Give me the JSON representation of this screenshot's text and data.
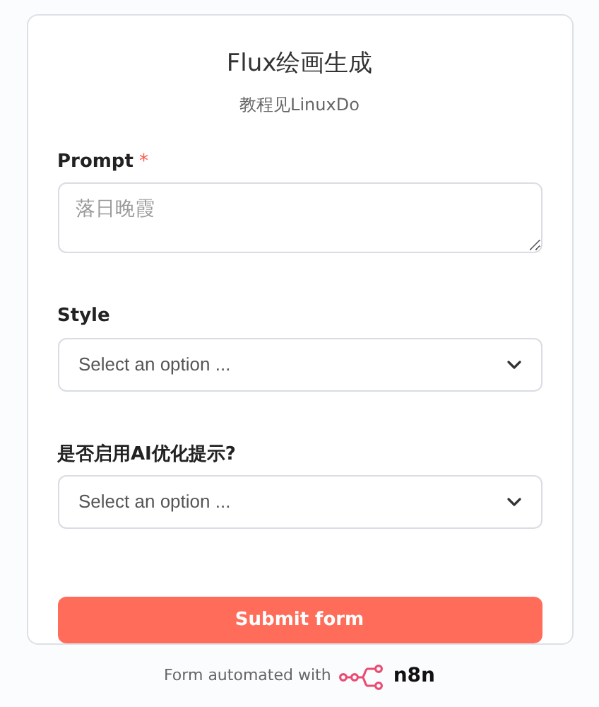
{
  "form": {
    "title": "Flux绘画生成",
    "subtitle": "教程见LinuxDo",
    "fields": [
      {
        "kind": "textarea",
        "label": "Prompt",
        "required_mark": "*",
        "placeholder": "落日晚霞"
      },
      {
        "kind": "select",
        "label": "Style",
        "placeholder": "Select an option ..."
      },
      {
        "kind": "select",
        "label": "是否启用AI优化提示?",
        "placeholder": "Select an option ..."
      }
    ],
    "submit": "Submit form"
  },
  "footer": {
    "text": "Form automated with",
    "brand": "n8n"
  }
}
